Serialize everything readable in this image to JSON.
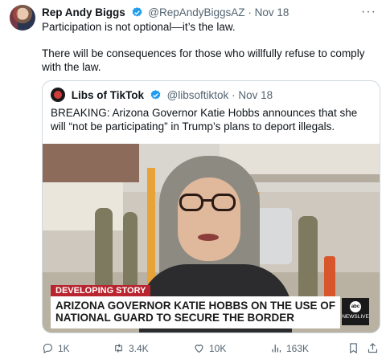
{
  "tweet": {
    "author_name": "Rep Andy Biggs",
    "handle": "@RepAndyBiggsAZ",
    "separator": "·",
    "date": "Nov 18",
    "more_label": "···",
    "paragraphs": [
      "Participation is not optional—it’s the law.",
      "There will be consequences for those who willfully refuse to comply with the law."
    ]
  },
  "quoted": {
    "author_name": "Libs of TikTok",
    "handle": "@libsoftiktok",
    "separator": "·",
    "date": "Nov 18",
    "text": "BREAKING: Arizona Governor Katie Hobbs announces that she will “not be participating” in Trump’s plans to deport illegals.",
    "media": {
      "tag": "DEVELOPING STORY",
      "headline_line1": "ARIZONA GOVERNOR KATIE HOBBS ON THE USE OF",
      "headline_line2": "NATIONAL GUARD TO SECURE THE BORDER",
      "network_logo": "abc",
      "network_name": "NEWSLIVE"
    }
  },
  "actions": {
    "reply_count": "1K",
    "retweet_count": "3.4K",
    "like_count": "10K",
    "view_count": "163K"
  },
  "icons": {
    "verified": "verified-badge-icon",
    "reply": "reply-icon",
    "retweet": "retweet-icon",
    "like": "heart-icon",
    "views": "views-icon",
    "bookmark": "bookmark-icon",
    "share": "share-icon"
  },
  "colors": {
    "verified_blue": "#1d9bf0",
    "muted_text": "#536471",
    "breaking_red": "#b8252f"
  }
}
